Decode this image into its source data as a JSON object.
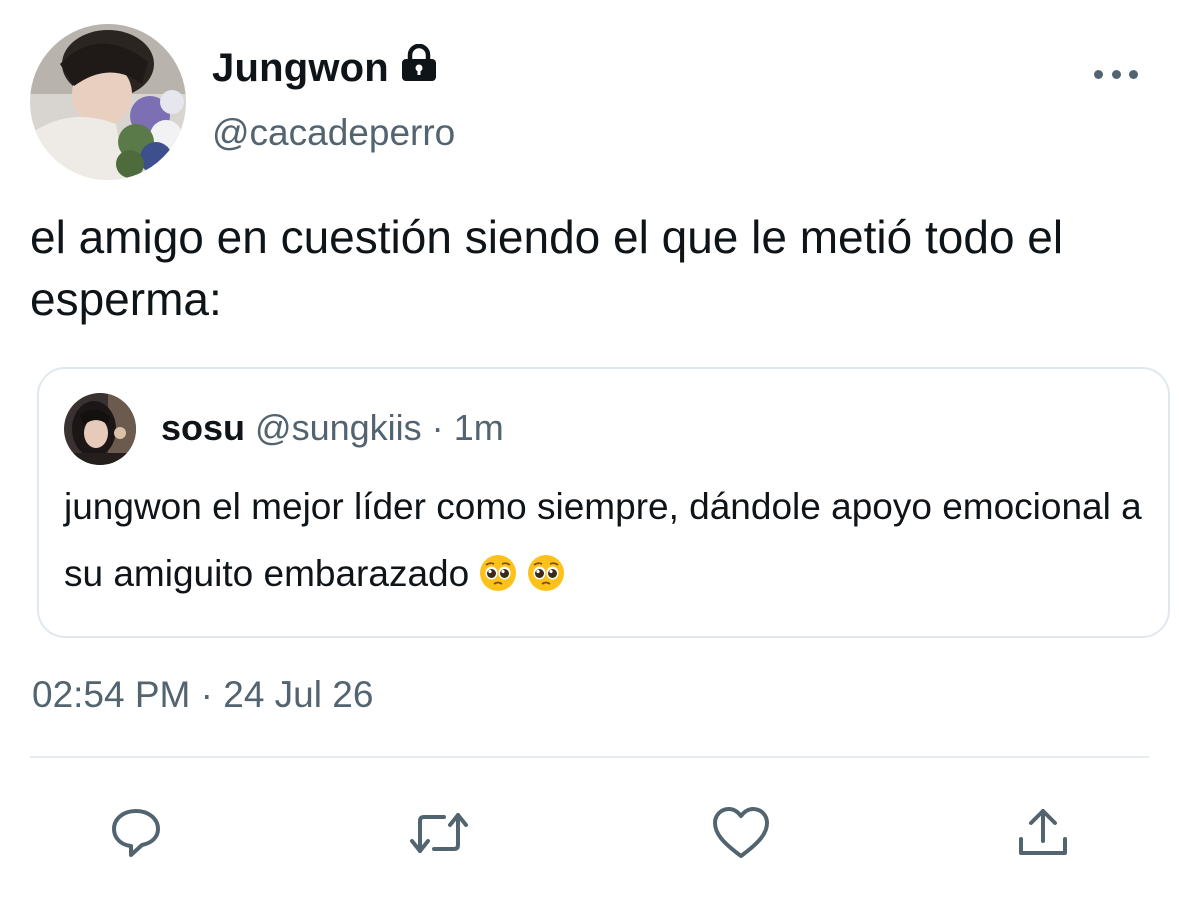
{
  "author": {
    "display_name": "Jungwon",
    "handle": "@cacadeperro",
    "protected_icon": "lock-icon",
    "avatar": "profile-photo"
  },
  "tweet": {
    "text": "el amigo en cuestión siendo el que le metió todo el esperma:",
    "timestamp": "02:54 PM · 24 Jul 26"
  },
  "quoted_tweet": {
    "display_name": "sosu",
    "handle": "@sungkiis",
    "separator": "·",
    "time": "1m",
    "text": "jungwon el mejor líder como siempre, dándole apoyo emocional a su amiguito embarazado",
    "emojis": [
      "pleading-face",
      "pleading-face"
    ]
  },
  "actions": [
    {
      "icon": "reply-icon"
    },
    {
      "icon": "retweet-icon"
    },
    {
      "icon": "like-icon"
    },
    {
      "icon": "share-icon"
    }
  ],
  "colors": {
    "text": "#0f1419",
    "secondary": "#536471",
    "border": "#e1e8ed",
    "divider": "#e6ecf0"
  }
}
